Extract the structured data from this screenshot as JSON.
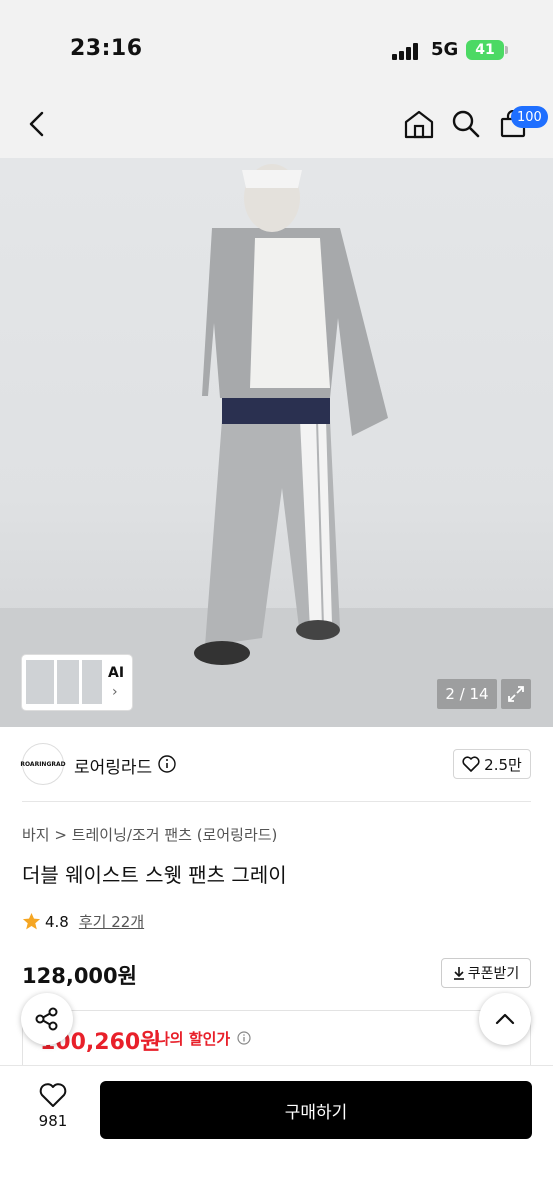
{
  "status_bar": {
    "time": "23:16",
    "network": "5G",
    "battery": "41"
  },
  "nav": {
    "cart_count": "100",
    "icons": [
      "back-icon",
      "home-icon",
      "search-icon",
      "cart-icon"
    ]
  },
  "gallery": {
    "counter": "2 / 14",
    "thumb_label": "AI"
  },
  "brand": {
    "logo_text": "ROARINGRAD",
    "name": "로어링라드",
    "likes": "2.5만"
  },
  "product": {
    "breadcrumb": "바지 > 트레이닝/조거 팬츠 (로어링라드)",
    "title": "더블 웨이스트 스웻 팬츠 그레이",
    "rating": "4.8",
    "review_link": "후기 22개",
    "price": "128,000원",
    "coupon_label": "쿠폰받기",
    "discount_price": "100,260원",
    "discount_label": "나의 할인가"
  },
  "bottom": {
    "wish_count": "981",
    "buy_label": "구매하기"
  },
  "colors": {
    "accent_blue": "#1f6fff",
    "discount_red": "#e8202a",
    "star": "#f5a623"
  }
}
